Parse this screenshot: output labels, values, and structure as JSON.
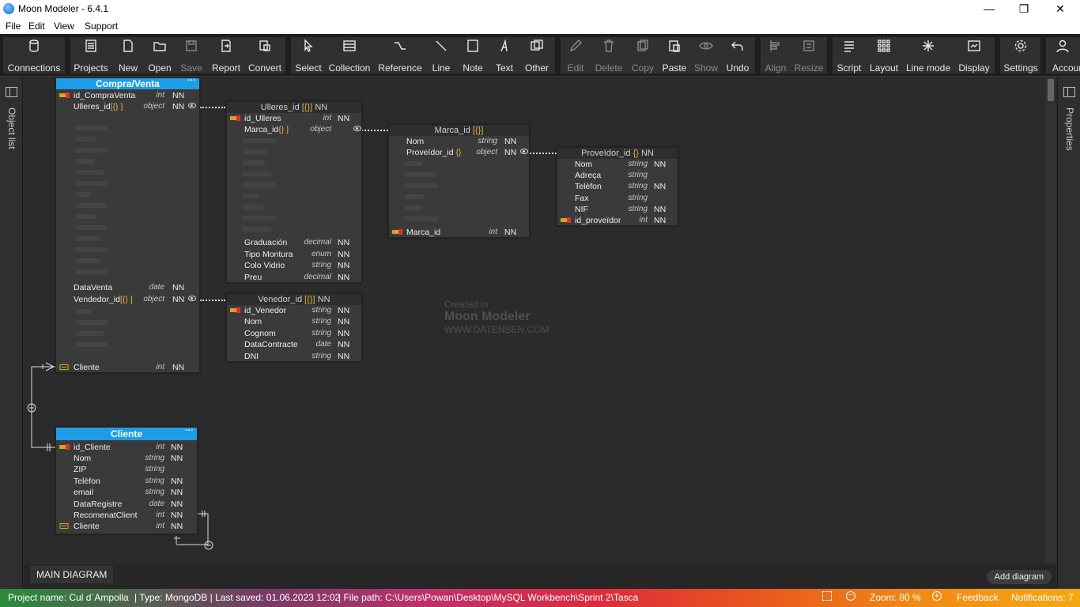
{
  "window": {
    "title": "Moon Modeler - 6.4.1",
    "minimize": "—",
    "maximize": "❐",
    "close": "✕"
  },
  "menu": [
    "File",
    "Edit",
    "View",
    "Support"
  ],
  "toolbar": {
    "connections": "Connections",
    "projects": "Projects",
    "new": "New",
    "open": "Open",
    "save": "Save",
    "report": "Report",
    "convert": "Convert",
    "select": "Select",
    "collection": "Collection",
    "reference": "Reference",
    "line": "Line",
    "note": "Note",
    "text": "Text",
    "other": "Other",
    "edit": "Edit",
    "delete": "Delete",
    "copy": "Copy",
    "paste": "Paste",
    "show": "Show",
    "undo": "Undo",
    "align": "Align",
    "resize": "Resize",
    "script": "Script",
    "layout": "Layout",
    "line_mode": "Line mode",
    "display": "Display",
    "settings": "Settings",
    "account": "Accoun"
  },
  "side": {
    "object_list": "Object list",
    "properties": "Properties"
  },
  "entities": {
    "compra": {
      "title": "Compra/Venta",
      "menu": "···",
      "rows": [
        {
          "name": "id_CompraVenta",
          "type": "int",
          "nn": "NN"
        },
        {
          "name": "Ulleres_id",
          "suffix": "[{} ]",
          "type": "object",
          "nn": "NN"
        },
        {
          "name": "DataVenta",
          "type": "date",
          "nn": "NN"
        },
        {
          "name": "Vendedor_id",
          "suffix": "[{} ]",
          "type": "object",
          "nn": "NN"
        },
        {
          "name": "Cliente",
          "type": "int",
          "nn": "NN"
        }
      ]
    },
    "ulleres": {
      "title": "Ulleres_id",
      "title_suffix": "[{}]",
      "title_nn": "NN",
      "rows": [
        {
          "name": "id_Ulleres",
          "type": "int",
          "nn": "NN"
        },
        {
          "name": "Marca_id",
          "suffix": "{} ]",
          "type": "object",
          "nn": ""
        },
        {
          "name": "Graduación",
          "type": "decimal",
          "nn": "NN"
        },
        {
          "name": "Tipo Montura",
          "type": "enum",
          "nn": "NN"
        },
        {
          "name": "Colo Vidrio",
          "type": "string",
          "nn": "NN"
        },
        {
          "name": "Preu",
          "type": "decimal",
          "nn": "NN"
        }
      ]
    },
    "marca": {
      "title": "Marca_id",
      "title_suffix": "[{}]",
      "rows": [
        {
          "name": "Nom",
          "type": "string",
          "nn": "NN"
        },
        {
          "name": "Proveïdor_id",
          "suffix": "{}",
          "type": "object",
          "nn": "NN"
        },
        {
          "name": "Marca_id",
          "type": "int",
          "nn": "NN"
        }
      ]
    },
    "proveidor": {
      "title": "Proveïdor_id",
      "title_suffix": "{}",
      "title_nn": "NN",
      "rows": [
        {
          "name": "Nom",
          "type": "string",
          "nn": "NN"
        },
        {
          "name": "Adreça",
          "type": "string",
          "nn": ""
        },
        {
          "name": "Telèfon",
          "type": "string",
          "nn": "NN"
        },
        {
          "name": "Fax",
          "type": "string",
          "nn": ""
        },
        {
          "name": "NIF",
          "type": "string",
          "nn": "NN"
        },
        {
          "name": "id_proveïdor",
          "type": "int",
          "nn": "NN"
        }
      ]
    },
    "venedor": {
      "title": "Venedor_id",
      "title_suffix": "[{}]",
      "title_nn": "NN",
      "rows": [
        {
          "name": "id_Venedor",
          "type": "string",
          "nn": "NN"
        },
        {
          "name": "Nom",
          "type": "string",
          "nn": "NN"
        },
        {
          "name": "Cognom",
          "type": "string",
          "nn": "NN"
        },
        {
          "name": "DataContracte",
          "type": "date",
          "nn": "NN"
        },
        {
          "name": "DNI",
          "type": "string",
          "nn": "NN"
        }
      ]
    },
    "cliente": {
      "title": "Cliente",
      "menu": "···",
      "rows": [
        {
          "name": "id_Cliente",
          "type": "int",
          "nn": "NN"
        },
        {
          "name": "Nom",
          "type": "string",
          "nn": "NN"
        },
        {
          "name": "ZIP",
          "type": "string",
          "nn": ""
        },
        {
          "name": "Telèfon",
          "type": "string",
          "nn": "NN"
        },
        {
          "name": "email",
          "type": "string",
          "nn": "NN"
        },
        {
          "name": "DataRegistre",
          "type": "date",
          "nn": "NN"
        },
        {
          "name": "RecomenatClient",
          "type": "int",
          "nn": "NN"
        },
        {
          "name": "Cliente",
          "type": "int",
          "nn": "NN"
        }
      ]
    }
  },
  "watermark": {
    "line1": "Created in",
    "line2": "Moon Modeler",
    "line3": "WWW.DATENSEN.COM"
  },
  "tabs": {
    "main": "MAIN DIAGRAM",
    "add": "Add diagram"
  },
  "status": {
    "project": "Project name: Cul d´Ampolla",
    "type": "| Type: MongoDB | Last saved: 01.06.2023 12:02",
    "path": "| File path: C:\\Users\\Powan\\Desktop\\MySQL Workbench\\Sprint 2\\Tasca",
    "zoom": "Zoom: 80 %",
    "feedback": "Feedback",
    "notifications": "Notifications: 7"
  }
}
